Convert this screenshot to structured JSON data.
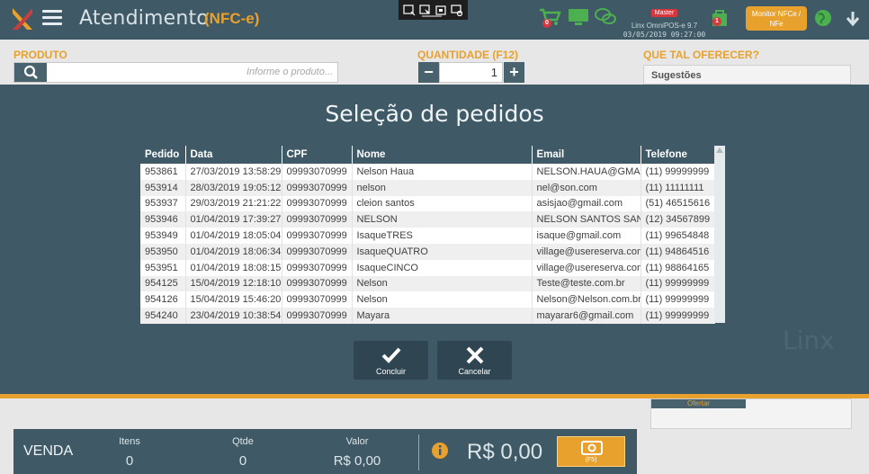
{
  "header": {
    "title": "Atendimento",
    "subtitle": "(NFC-e)",
    "master_tag": "Master",
    "version": "Linx OmniPOS-e  9.7",
    "datetime": "03/05/2019 09:27:00",
    "cart_count": "0",
    "bag_count": "1",
    "monitor_button": "Monitor NFCe / NFe"
  },
  "product": {
    "label": "PRODUTO",
    "search_placeholder": "Informe o produto...",
    "quantity_label": "QUANTIDADE (F12)",
    "quantity_value": "1",
    "offer_label": "QUE TAL OFERECER?",
    "suggestions_label": "Sugestões"
  },
  "modal": {
    "title": "Seleção de pedidos",
    "columns": [
      "Pedido",
      "Data",
      "CPF",
      "Nome",
      "Email",
      "Telefone"
    ],
    "rows": [
      [
        "953861",
        "27/03/2019 13:58:29",
        "09993070999",
        "Nelson Haua",
        "NELSON.HAUA@GMAIL",
        "(11) 99999999"
      ],
      [
        "953914",
        "28/03/2019 19:05:12",
        "09993070999",
        "nelson",
        "nel@son.com",
        "(11) 11111111"
      ],
      [
        "953937",
        "29/03/2019 21:21:22",
        "09993070999",
        "cleion santos",
        "asisjao@gmail.com",
        "(51) 46515616"
      ],
      [
        "953946",
        "01/04/2019 17:39:27",
        "09993070999",
        "NELSON",
        "NELSON SANTOS SANT",
        "(12) 34567899"
      ],
      [
        "953949",
        "01/04/2019 18:05:04",
        "09993070999",
        "IsaqueTRES",
        "isaque@gmail.com",
        "(11) 99654848"
      ],
      [
        "953950",
        "01/04/2019 18:06:34",
        "09993070999",
        "IsaqueQUATRO",
        "village@usereserva.com",
        "(11) 94864516"
      ],
      [
        "953951",
        "01/04/2019 18:08:15",
        "09993070999",
        "IsaqueCINCO",
        "village@usereserva.com",
        "(11) 98864165"
      ],
      [
        "954125",
        "15/04/2019 12:18:10",
        "09993070999",
        "Nelson",
        "Teste@teste.com.br",
        "(11) 99999999"
      ],
      [
        "954126",
        "15/04/2019 15:46:20",
        "09993070999",
        "Nelson",
        "Nelson@Nelson.com.br",
        "(11) 99999999"
      ],
      [
        "954240",
        "23/04/2019 10:38:54",
        "09993070999",
        "Mayara",
        "mayarar6@gmail.com",
        "(11) 99999999"
      ]
    ],
    "confirm_label": "Concluir",
    "cancel_label": "Cancelar",
    "watermark": "Linx"
  },
  "lower_right": {
    "offer_button": "Ofertar"
  },
  "summary": {
    "sale_label": "VENDA",
    "items_label": "Itens",
    "items_value": "0",
    "qty_label": "Qtde",
    "qty_value": "0",
    "value_label": "Valor",
    "value_value": "R$ 0,00",
    "total": "R$ 0,00",
    "pay_key": "(F5)"
  },
  "colors": {
    "brand_dark": "#3f5a66",
    "accent_orange": "#e8a12d",
    "icon_green": "#4caf50",
    "badge_red": "#d9363e"
  }
}
